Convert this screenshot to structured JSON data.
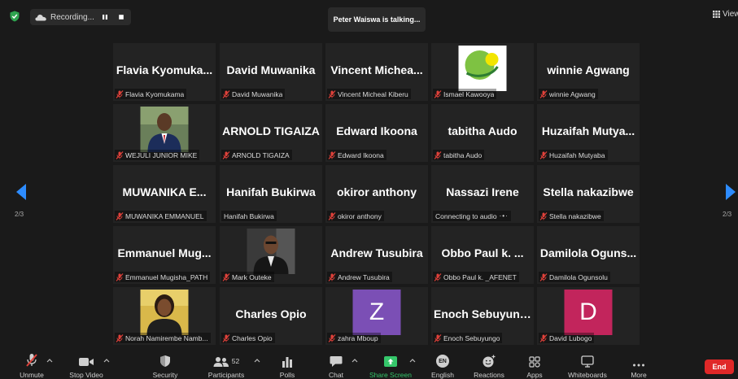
{
  "topbar": {
    "recording_label": "Recording...",
    "talking": "Peter Waiswa is talking...",
    "view_label": "View"
  },
  "tiles": [
    {
      "name": "Flavia  Kyomuka...",
      "label": "Flavia Kyomukama",
      "muted": true
    },
    {
      "name": "David Muwanika",
      "label": "David Muwanika",
      "muted": true
    },
    {
      "name": "Vincent  Michea...",
      "label": "Vincent Micheal Kiberu",
      "muted": true
    },
    {
      "name": "",
      "label": "Ismael Kawooya",
      "muted": true,
      "media": "logo"
    },
    {
      "name": "winnie Agwang",
      "label": "winnie Agwang",
      "muted": true
    },
    {
      "name": "",
      "label": "WEJULI JUNIOR MIKE",
      "muted": true,
      "media": "photo-man"
    },
    {
      "name": "ARNOLD TIGAIZA",
      "label": "ARNOLD TIGAIZA",
      "muted": true
    },
    {
      "name": "Edward Ikoona",
      "label": "Edward Ikoona",
      "muted": true
    },
    {
      "name": "tabitha Audo",
      "label": "tabitha Audo",
      "muted": true
    },
    {
      "name": "Huzaifah  Mutya...",
      "label": "Huzaifah Mutyaba",
      "muted": true
    },
    {
      "name": "MUWANIKA  E...",
      "label": "MUWANIKA EMMANUEL",
      "muted": true
    },
    {
      "name": "Hanifah Bukirwa",
      "label": "Hanifah Bukirwa",
      "muted": false
    },
    {
      "name": "okiror anthony",
      "label": "okiror anthony",
      "muted": true
    },
    {
      "name": "Nassazi Irene",
      "label": "Connecting to audio",
      "muted": false,
      "connecting": true
    },
    {
      "name": "Stella nakazibwe",
      "label": "Stella nakazibwe",
      "muted": true
    },
    {
      "name": "Emmanuel  Mug...",
      "label": "Emmanuel Mugisha_PATH",
      "muted": true
    },
    {
      "name": "",
      "label": "Mark Outeke",
      "muted": true,
      "media": "photo-suit"
    },
    {
      "name": "Andrew Tusubira",
      "label": "Andrew Tusubira",
      "muted": true
    },
    {
      "name": "Obbo Paul k. ...",
      "label": "Obbo Paul k. _AFENET",
      "muted": true
    },
    {
      "name": "Damilola  Oguns...",
      "label": "Damilola Ogunsolu",
      "muted": true
    },
    {
      "name": "",
      "label": "Norah Namirembe Namb...",
      "muted": true,
      "media": "photo-woman"
    },
    {
      "name": "Charles Opio",
      "label": "Charles Opio",
      "muted": true
    },
    {
      "name": "",
      "label": "zahra Mboup",
      "muted": true,
      "media": "avatar",
      "letter": "Z",
      "color": "#7b4fb5"
    },
    {
      "name": "Enoch Sebuyungo",
      "label": "Enoch Sebuyungo",
      "muted": true
    },
    {
      "name": "",
      "label": "David Lubogo",
      "muted": true,
      "media": "avatar",
      "letter": "D",
      "color": "#c2255c"
    }
  ],
  "pagination": {
    "left": "2/3",
    "right": "2/3"
  },
  "toolbar": {
    "unmute": "Unmute",
    "stop_video": "Stop Video",
    "security": "Security",
    "participants": "Participants",
    "participants_count": "52",
    "polls": "Polls",
    "chat": "Chat",
    "share_screen": "Share Screen",
    "english": "English",
    "english_badge": "EN",
    "reactions": "Reactions",
    "apps": "Apps",
    "whiteboards": "Whiteboards",
    "more": "More",
    "end": "End"
  },
  "colors": {
    "muted_icon": "#e0413a",
    "share_green": "#35c76b",
    "end_red": "#e02828",
    "arrow_blue": "#2d8cff"
  }
}
